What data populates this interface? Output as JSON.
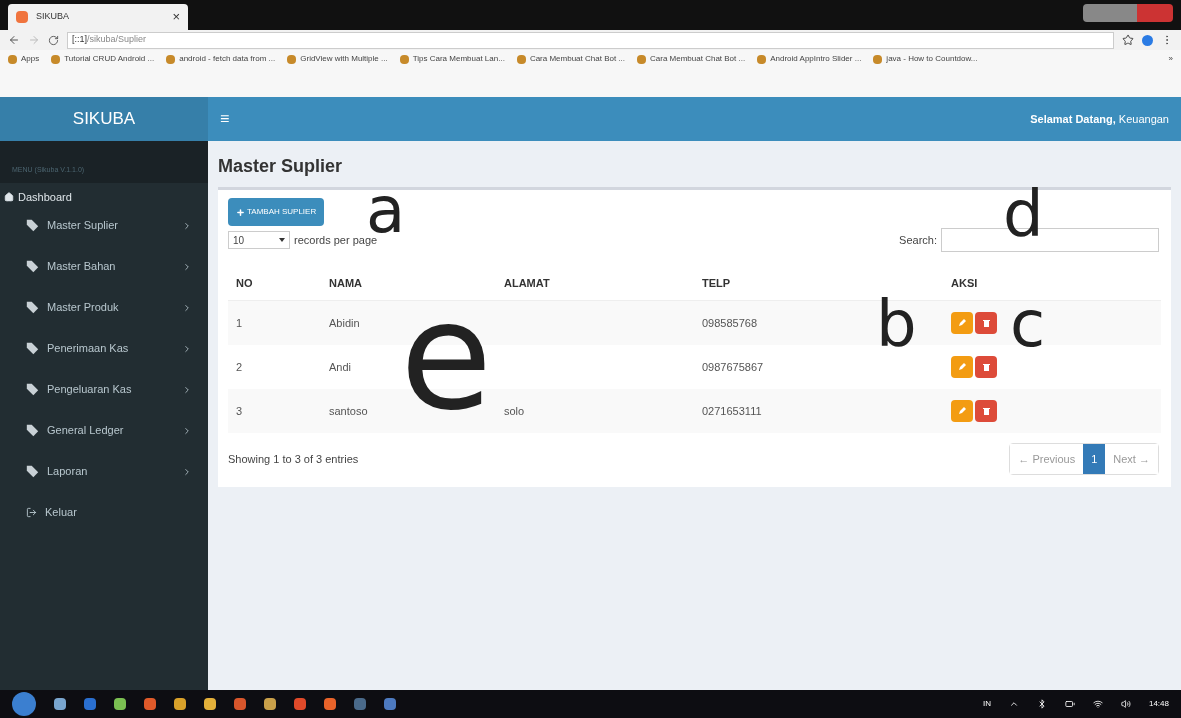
{
  "browser": {
    "tab_title": "SIKUBA",
    "tab_close": "×",
    "url_host": "[::1]",
    "url_path": "/sikuba/Suplier",
    "bookmarks": [
      "Apps",
      "Tutorial CRUD Android ...",
      "android - fetch data from ...",
      "GridView with Multiple ...",
      "Tips Cara Membuat Lan...",
      "Cara Membuat Chat Bot ...",
      "Cara Membuat Chat Bot ...",
      "Android AppIntro Slider ...",
      "java - How to Countdow..."
    ],
    "more": "»"
  },
  "header": {
    "brand": "SIKUBA",
    "menu_glyph": "≡",
    "greeting": "Selamat Datang,",
    "user": "Keuangan"
  },
  "sidebar": {
    "caption": "MENU (Sikuba V.1.1.0)",
    "dashboard": "Dashboard",
    "items": [
      {
        "label": "Master Suplier",
        "kind": "submenu"
      },
      {
        "label": "Master Bahan",
        "kind": "submenu"
      },
      {
        "label": "Master Produk",
        "kind": "submenu"
      },
      {
        "label": "Penerimaan Kas",
        "kind": "submenu"
      },
      {
        "label": "Pengeluaran Kas",
        "kind": "submenu"
      },
      {
        "label": "General Ledger",
        "kind": "submenu"
      },
      {
        "label": "Laporan",
        "kind": "submenu"
      },
      {
        "label": "Keluar",
        "kind": "logout"
      }
    ]
  },
  "page": {
    "title": "Master Suplier",
    "add_button": "TAMBAH SUPLIER",
    "page_size": "10",
    "page_size_label": "records per page",
    "search_label": "Search:",
    "table": {
      "columns": [
        "NO",
        "NAMA",
        "ALAMAT",
        "TELP",
        "AKSI"
      ],
      "rows": [
        {
          "no": "1",
          "nama": "Abidin",
          "telp": "098585768"
        },
        {
          "no": "2",
          "nama": "Andi",
          "telp": "0987675867"
        },
        {
          "no": "3",
          "nama": "santoso",
          "alamat": "solo",
          "telp": "0271653111"
        }
      ]
    },
    "info": "Showing 1 to 3 of 3 entries",
    "pagination": [
      {
        "label": "← Previous",
        "selected": false
      },
      {
        "label": "1",
        "selected": true
      },
      {
        "label": "Next →",
        "selected": false
      }
    ]
  },
  "annotations": [
    "a",
    "d",
    "e",
    "b",
    "c"
  ],
  "taskbar": {
    "lang": "IN",
    "time": "14:48"
  }
}
